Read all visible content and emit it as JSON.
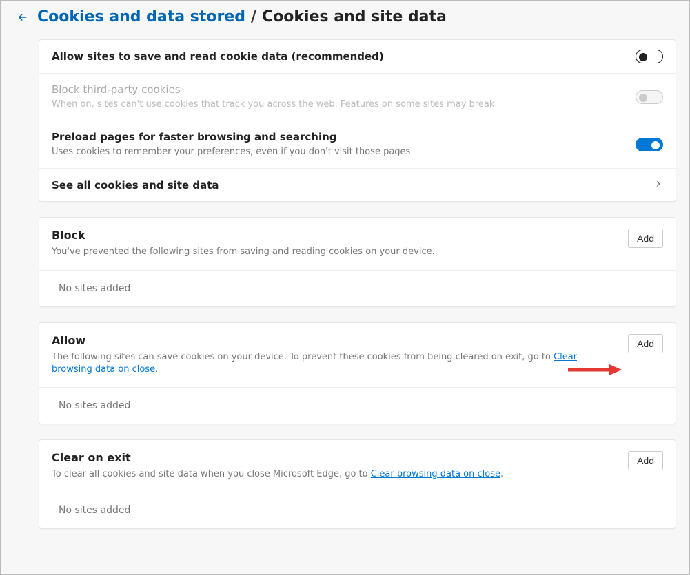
{
  "breadcrumb": {
    "parent": "Cookies and data stored",
    "separator": "/",
    "current": "Cookies and site data"
  },
  "settings_group": {
    "allow_cookies": {
      "title": "Allow sites to save and read cookie data (recommended)",
      "state": "off"
    },
    "block_third_party": {
      "title": "Block third-party cookies",
      "desc": "When on, sites can't use cookies that track you across the web. Features on some sites may break.",
      "state": "disabled-off"
    },
    "preload": {
      "title": "Preload pages for faster browsing and searching",
      "desc": "Uses cookies to remember your preferences, even if you don't visit those pages",
      "state": "on"
    },
    "see_all": {
      "title": "See all cookies and site data"
    }
  },
  "block_section": {
    "title": "Block",
    "desc": "You've prevented the following sites from saving and reading cookies on your device.",
    "add_label": "Add",
    "empty": "No sites added"
  },
  "allow_section": {
    "title": "Allow",
    "desc_pre": "The following sites can save cookies on your device. To prevent these cookies from being cleared on exit, go to ",
    "desc_link": "Clear browsing data on close",
    "desc_post": ".",
    "add_label": "Add",
    "empty": "No sites added"
  },
  "clear_section": {
    "title": "Clear on exit",
    "desc_pre": "To clear all cookies and site data when you close Microsoft Edge, go to ",
    "desc_link": "Clear browsing data on close",
    "desc_post": ".",
    "add_label": "Add",
    "empty": "No sites added"
  }
}
